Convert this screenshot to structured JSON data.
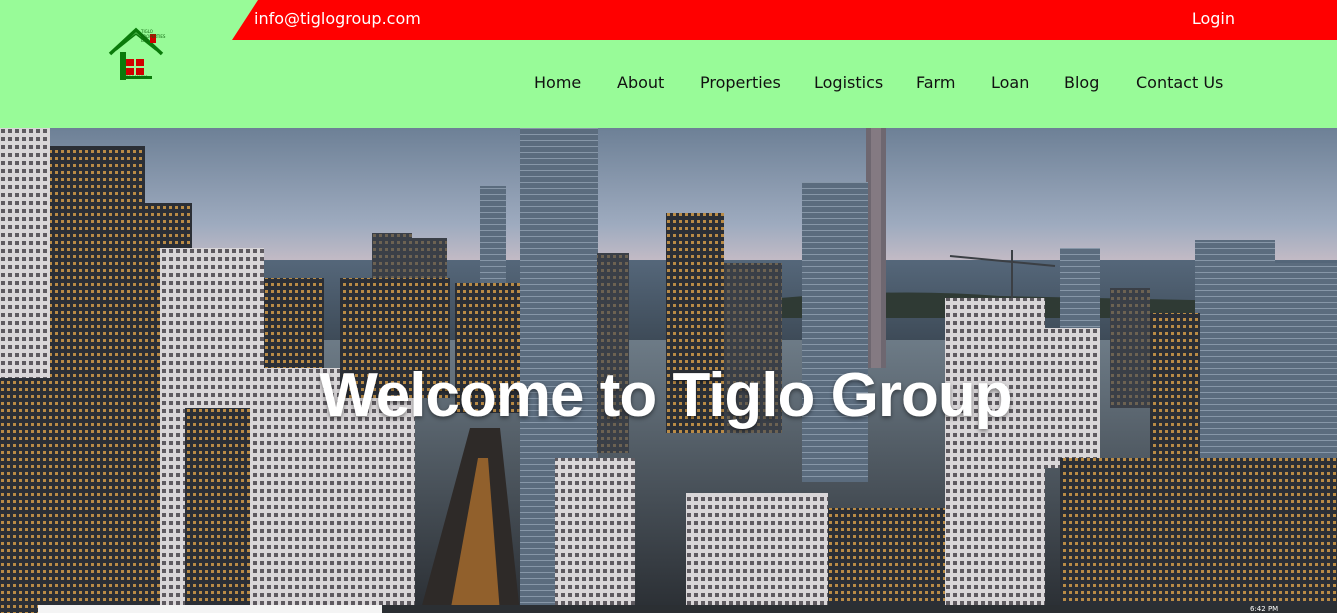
{
  "topbar": {
    "email": "info@tiglogroup.com",
    "login_label": "Login"
  },
  "logo": {
    "line1": "TIGLO",
    "line2": "PROPERTIES",
    "line3": "LTD.",
    "line4": "RC:1449796",
    "icon": "house-logo-icon"
  },
  "nav": {
    "items": [
      "Home",
      "About",
      "Properties",
      "Logistics",
      "Farm",
      "Loan",
      "Blog",
      "Contact Us"
    ]
  },
  "hero": {
    "title": "Welcome to Tiglo Group"
  },
  "taskbar": {
    "time": "6:42 PM"
  },
  "colors": {
    "header_bg": "#98fb98",
    "topbar_bg": "#ff0000",
    "logo_green": "#0a7a0a",
    "logo_red": "#d10000"
  }
}
